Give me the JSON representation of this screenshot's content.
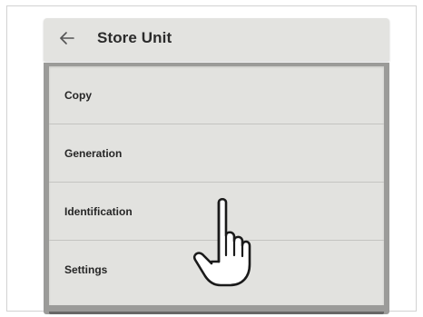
{
  "header": {
    "back_icon": "arrow-left-icon",
    "title": "Store Unit"
  },
  "menu": {
    "items": [
      {
        "label": "Copy"
      },
      {
        "label": "Generation"
      },
      {
        "label": "Identification"
      },
      {
        "label": "Settings"
      }
    ]
  },
  "overlay": {
    "cursor_icon": "hand-pointer-icon"
  },
  "colors": {
    "app_bar_bg": "#e3e3e0",
    "menu_bg": "#e2e2df",
    "panel_border": "#9b9b99",
    "text": "#262626"
  }
}
